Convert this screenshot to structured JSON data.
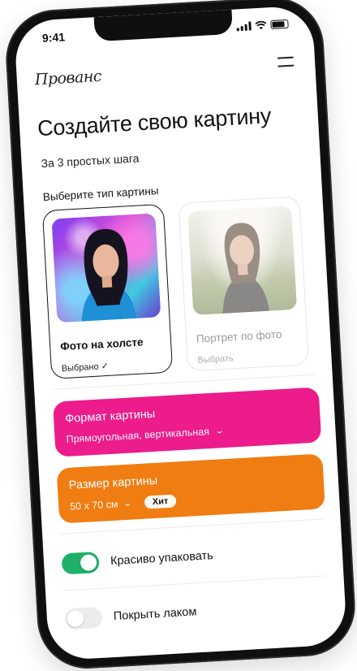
{
  "status_bar": {
    "time": "9:41"
  },
  "header": {
    "logo": "Прованс",
    "menu_icon": "hamburger-icon"
  },
  "main": {
    "title": "Создайте свою картину",
    "subtitle": "За 3 простых шага",
    "section_label": "Выберите тип картины",
    "cards": [
      {
        "name": "Фото на холсте",
        "status": "Выбрано ✓",
        "selected": true
      },
      {
        "name": "Портрет по фото",
        "status": "Выбрать",
        "selected": false
      }
    ],
    "format": {
      "title": "Формат картины",
      "value": "Прямоугольная, вертикальная",
      "color": "#ec1c8c"
    },
    "size": {
      "title": "Размер картины",
      "value": "50 х 70 см",
      "badge": "Хит",
      "color": "#f07d12"
    },
    "toggles": [
      {
        "label": "Красиво упаковать",
        "on": true
      },
      {
        "label": "Покрыть лаком",
        "on": false
      }
    ]
  },
  "colors": {
    "accent_green": "#1fb06a"
  }
}
